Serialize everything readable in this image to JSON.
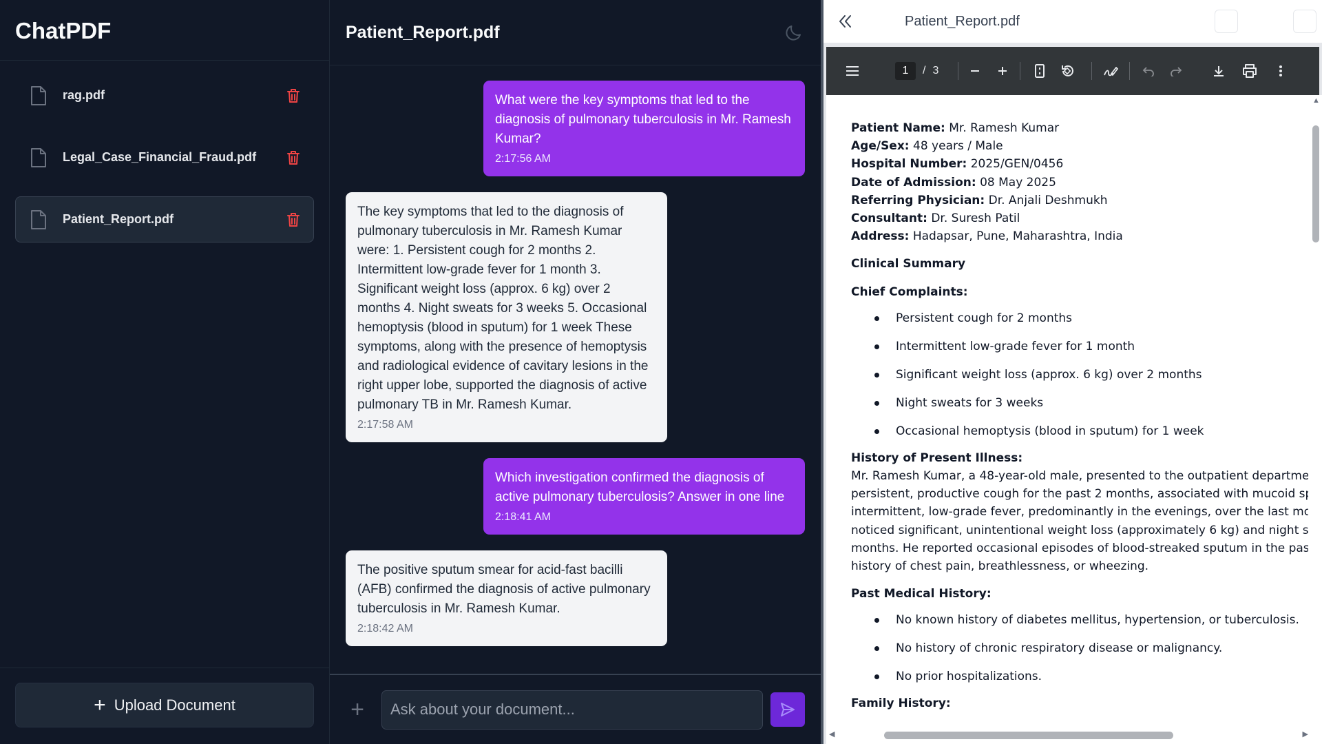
{
  "sidebar": {
    "brand": "ChatPDF",
    "files": [
      {
        "name": "rag.pdf",
        "active": false
      },
      {
        "name": "Legal_Case_Financial_Fraud.pdf",
        "active": false
      },
      {
        "name": "Patient_Report.pdf",
        "active": true
      }
    ],
    "upload_label": "Upload Document"
  },
  "chat": {
    "title": "Patient_Report.pdf",
    "messages": [
      {
        "role": "user",
        "text": "What were the key symptoms that led to the diagnosis of pulmonary tuberculosis in Mr. Ramesh Kumar?",
        "time": "2:17:56 AM"
      },
      {
        "role": "bot",
        "text": "The key symptoms that led to the diagnosis of pulmonary tuberculosis in Mr. Ramesh Kumar were: 1. Persistent cough for 2 months 2. Intermittent low-grade fever for 1 month 3. Significant weight loss (approx. 6 kg) over 2 months 4. Night sweats for 3 weeks 5. Occasional hemoptysis (blood in sputum) for 1 week These symptoms, along with the presence of hemoptysis and radiological evidence of cavitary lesions in the right upper lobe, supported the diagnosis of active pulmonary TB in Mr. Ramesh Kumar.",
        "time": "2:17:58 AM"
      },
      {
        "role": "user",
        "text": "Which investigation confirmed the diagnosis of active pulmonary tuberculosis? Answer in one line",
        "time": "2:18:41 AM"
      },
      {
        "role": "bot",
        "text": "The positive sputum smear for acid-fast bacilli (AFB) confirmed the diagnosis of active pulmonary tuberculosis in Mr. Ramesh Kumar.",
        "time": "2:18:42 AM"
      }
    ],
    "input_placeholder": "Ask about your document..."
  },
  "pdf": {
    "title": "Patient_Report.pdf",
    "toolbar": {
      "page_current": "1",
      "page_separator": "/",
      "page_total": "3"
    },
    "fields": [
      {
        "label": "Patient Name:",
        "value": " Mr. Ramesh Kumar"
      },
      {
        "label": "Age/Sex:",
        "value": " 48 years / Male"
      },
      {
        "label": "Hospital Number:",
        "value": " 2025/GEN/0456"
      },
      {
        "label": "Date of Admission:",
        "value": " 08 May 2025"
      },
      {
        "label": "Referring Physician:",
        "value": " Dr. Anjali Deshmukh"
      },
      {
        "label": "Consultant:",
        "value": " Dr. Suresh Patil"
      },
      {
        "label": "Address:",
        "value": " Hadapsar, Pune, Maharashtra, India"
      }
    ],
    "clinical_summary": "Clinical Summary",
    "chief_complaints_heading": "Chief Complaints:",
    "chief_complaints": [
      "Persistent cough for 2 months",
      "Intermittent low-grade fever for 1 month",
      "Significant weight loss (approx. 6 kg) over 2 months",
      "Night sweats for 3 weeks",
      "Occasional hemoptysis (blood in sputum) for 1 week"
    ],
    "hpi_heading": "History of Present Illness:",
    "hpi_lines": [
      "Mr. Ramesh Kumar, a 48-year-old male, presented to the outpatient department w",
      "persistent, productive cough for the past 2 months, associated with mucoid sputur",
      "intermittent, low-grade fever, predominantly in the evenings, over the last month.",
      "noticed significant, unintentional weight loss (approximately 6 kg) and night sweat",
      "months. He reported occasional episodes of blood-streaked sputum in the past we",
      "history of chest pain, breathlessness, or wheezing."
    ],
    "pmh_heading": "Past Medical History:",
    "pmh_items": [
      "No known history of diabetes mellitus, hypertension, or tuberculosis.",
      "No history of chronic respiratory disease or malignancy.",
      "No prior hospitalizations."
    ],
    "family_heading": "Family History:"
  },
  "colors": {
    "app_bg": "#111827",
    "user_bubble": "#9333ea",
    "bot_bubble": "#f3f4f6",
    "delete": "#ef4444",
    "send": "#6d28d9",
    "pdf_toolbar": "#323639"
  },
  "icons": {
    "file": "file-icon",
    "delete": "trash-icon",
    "theme": "moon-icon",
    "upload": "plus-icon",
    "attach": "plus-icon",
    "send": "send-icon",
    "collapse": "double-chevron-left-icon"
  }
}
